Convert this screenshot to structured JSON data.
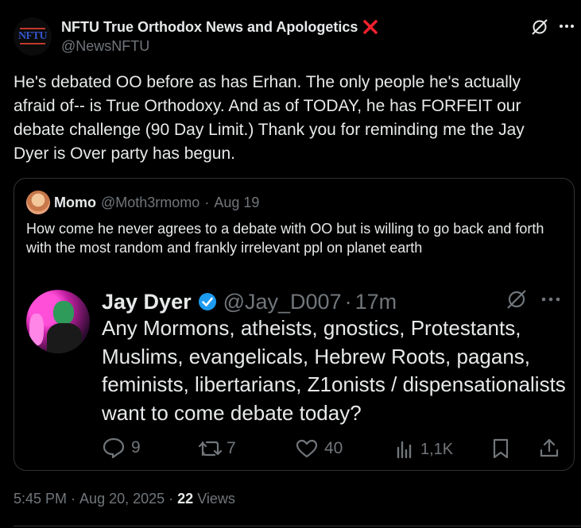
{
  "post": {
    "author": {
      "name": "NFTU True Orthodox News and Apologetics",
      "handle": "@NewsNFTU",
      "avatar_text": "NFTU"
    },
    "body": "He's debated OO before as has Erhan. The only people he's actually afraid of-- is True Orthodoxy. And as of TODAY, he has FORFEIT our debate challenge (90 Day Limit.) Thank you for reminding me the Jay Dyer is Over party has begun.",
    "icons": [
      "grok-icon",
      "more-icon"
    ],
    "footer": {
      "time": "5:45 PM",
      "sep1": "·",
      "date": "Aug 20, 2025",
      "sep2": "·",
      "views_count": "22",
      "views_label": "Views"
    }
  },
  "quote": {
    "author": {
      "name": "Momo",
      "handle": "@Moth3rmomo",
      "sep": "·",
      "date": "Aug 19"
    },
    "body": "How come he never agrees to a debate with OO but is willing to go back and forth with the most random and frankly irrelevant ppl on planet earth",
    "screenshot": {
      "name": "Jay Dyer",
      "handle": "@Jay_D007",
      "sep": "·",
      "time": "17m",
      "body": "Any Mormons, atheists, gnostics, Protestants, Muslims, evangelicals, Hebrew Roots, pagans, feminists, libertarians, Z1onists / dispensationalists want to come debate today?",
      "actions": {
        "replies": "9",
        "reposts": "7",
        "likes": "40",
        "views": "1,1K"
      }
    }
  },
  "colors": {
    "background": "#000000",
    "text": "#e7e9ea",
    "muted": "#71767b",
    "verified": "#1d9bf0",
    "close_x": "#f4212e"
  }
}
